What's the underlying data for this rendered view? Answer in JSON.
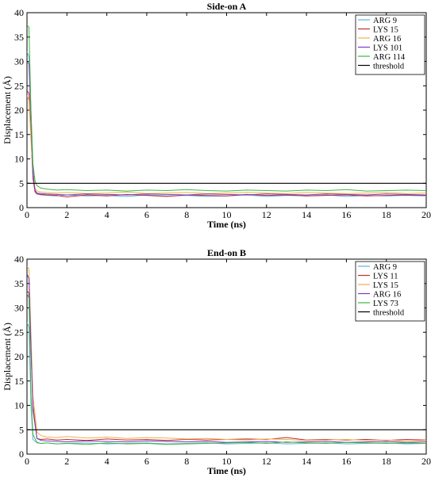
{
  "chart_data": [
    {
      "type": "line",
      "title": "Side-on A",
      "xlabel": "Time (ns)",
      "ylabel": "Displacement (Å)",
      "xlim": [
        0,
        20
      ],
      "ylim": [
        0,
        40
      ],
      "xticks": [
        "0",
        "2",
        "4",
        "6",
        "8",
        "10",
        "12",
        "14",
        "16",
        "18",
        "20"
      ],
      "yticks": [
        "0",
        "5",
        "10",
        "15",
        "20",
        "25",
        "30",
        "35",
        "40"
      ],
      "grid": false,
      "legend_position": "top-right",
      "series": [
        {
          "name": "ARG 9",
          "color": "#5fb4dc",
          "x": [
            0,
            0.1,
            0.2,
            0.3,
            0.4,
            0.5,
            0.7,
            1,
            1.5,
            2,
            3,
            4,
            5,
            6,
            7,
            8,
            9,
            10,
            11,
            12,
            13,
            14,
            15,
            16,
            17,
            18,
            19,
            20
          ],
          "y": [
            32,
            31,
            20,
            8,
            3.5,
            2.8,
            2.6,
            2.5,
            2.4,
            2.6,
            2.4,
            2.5,
            2.3,
            2.6,
            2.4,
            2.5,
            2.3,
            2.4,
            2.6,
            2.3,
            2.5,
            2.4,
            2.6,
            2.3,
            2.5,
            2.4,
            2.5,
            2.4
          ]
        },
        {
          "name": "LYS 15",
          "color": "#c03030",
          "x": [
            0,
            0.1,
            0.2,
            0.3,
            0.4,
            0.5,
            0.7,
            1,
            1.5,
            2,
            3,
            4,
            5,
            6,
            7,
            8,
            9,
            10,
            11,
            12,
            13,
            14,
            15,
            16,
            17,
            18,
            19,
            20
          ],
          "y": [
            24,
            23.5,
            15,
            6,
            3.2,
            2.8,
            2.7,
            2.6,
            2.5,
            2.2,
            2.6,
            2.4,
            2.7,
            2.5,
            2.3,
            2.6,
            2.5,
            2.4,
            2.7,
            2.5,
            2.6,
            2.4,
            2.5,
            2.6,
            2.4,
            2.5,
            2.6,
            2.5
          ]
        },
        {
          "name": "ARG 16",
          "color": "#f0b04a",
          "x": [
            0,
            0.1,
            0.2,
            0.3,
            0.4,
            0.5,
            0.7,
            1,
            1.5,
            2,
            3,
            4,
            5,
            6,
            7,
            8,
            9,
            10,
            11,
            12,
            13,
            14,
            15,
            16,
            17,
            18,
            19,
            20
          ],
          "y": [
            23,
            22,
            14,
            7,
            4,
            3.4,
            3.2,
            3.1,
            3.0,
            3.1,
            2.9,
            3.0,
            3.2,
            2.9,
            3.0,
            3.1,
            2.9,
            3.0,
            3.1,
            3.0,
            2.9,
            3.1,
            3.0,
            2.9,
            3.0,
            3.1,
            2.9,
            3.0
          ]
        },
        {
          "name": "LYS 101",
          "color": "#7a3cc8",
          "x": [
            0,
            0.1,
            0.2,
            0.3,
            0.4,
            0.5,
            0.7,
            1,
            1.5,
            2,
            3,
            4,
            5,
            6,
            7,
            8,
            9,
            10,
            11,
            12,
            13,
            14,
            15,
            16,
            17,
            18,
            19,
            20
          ],
          "y": [
            30,
            29.5,
            18,
            7,
            3.6,
            3.0,
            2.9,
            2.8,
            2.7,
            2.6,
            2.8,
            2.7,
            2.6,
            2.8,
            2.7,
            2.6,
            2.8,
            2.7,
            2.6,
            2.8,
            2.7,
            2.6,
            2.8,
            2.7,
            2.6,
            2.8,
            2.7,
            2.6
          ]
        },
        {
          "name": "ARG 114",
          "color": "#3cb83c",
          "x": [
            0,
            0.1,
            0.2,
            0.3,
            0.4,
            0.5,
            0.7,
            1,
            1.5,
            2,
            3,
            4,
            5,
            6,
            7,
            8,
            9,
            10,
            11,
            12,
            13,
            14,
            15,
            16,
            17,
            18,
            19,
            20
          ],
          "y": [
            37.5,
            37,
            20,
            9,
            5.5,
            4.5,
            4.0,
            3.8,
            3.6,
            3.7,
            3.5,
            3.6,
            3.4,
            3.6,
            3.5,
            3.7,
            3.5,
            3.4,
            3.6,
            3.5,
            3.4,
            3.6,
            3.5,
            3.7,
            3.4,
            3.5,
            3.6,
            3.5
          ]
        },
        {
          "name": "threshold",
          "color": "#000000",
          "x": [
            0,
            20
          ],
          "y": [
            5,
            5
          ]
        }
      ]
    },
    {
      "type": "line",
      "title": "End-on B",
      "xlabel": "Time (ns)",
      "ylabel": "Displacement (Å)",
      "xlim": [
        0,
        20
      ],
      "ylim": [
        0,
        40
      ],
      "xticks": [
        "0",
        "2",
        "4",
        "6",
        "8",
        "10",
        "12",
        "14",
        "16",
        "18",
        "20"
      ],
      "yticks": [
        "0",
        "5",
        "10",
        "15",
        "20",
        "25",
        "30",
        "35",
        "40"
      ],
      "grid": false,
      "legend_position": "top-right",
      "series": [
        {
          "name": "ARG 9",
          "color": "#5fb4dc",
          "x": [
            0,
            0.1,
            0.2,
            0.3,
            0.5,
            0.7,
            1,
            1.5,
            2,
            3,
            4,
            5,
            6,
            7,
            8,
            9,
            10,
            11,
            12,
            13,
            14,
            15,
            16,
            17,
            18,
            19,
            20
          ],
          "y": [
            27,
            26,
            10,
            3,
            2.3,
            2.2,
            2.3,
            2.1,
            2.2,
            2.3,
            2.1,
            2.2,
            2.3,
            2.1,
            2.2,
            2.3,
            2.1,
            2.2,
            2.3,
            2.1,
            2.2,
            2.3,
            2.1,
            2.2,
            2.3,
            2.1,
            2.2
          ]
        },
        {
          "name": "LYS 11",
          "color": "#c03030",
          "x": [
            0,
            0.1,
            0.2,
            0.3,
            0.5,
            0.7,
            1,
            1.5,
            2,
            3,
            4,
            5,
            6,
            7,
            8,
            9,
            10,
            11,
            12,
            13,
            14,
            15,
            16,
            17,
            18,
            19,
            20
          ],
          "y": [
            33.5,
            33,
            22,
            10,
            3.2,
            3.0,
            3.1,
            2.9,
            3.0,
            2.8,
            3.1,
            2.9,
            3.0,
            2.8,
            3.0,
            2.9,
            3.0,
            3.1,
            3.0,
            3.4,
            2.9,
            3.0,
            2.9,
            3.0,
            2.8,
            3.0,
            2.9
          ]
        },
        {
          "name": "LYS 15",
          "color": "#f0b04a",
          "x": [
            0,
            0.1,
            0.2,
            0.3,
            0.5,
            0.7,
            1,
            1.5,
            2,
            3,
            4,
            5,
            6,
            7,
            8,
            9,
            10,
            11,
            12,
            13,
            14,
            15,
            16,
            17,
            18,
            19,
            20
          ],
          "y": [
            38.5,
            38,
            25,
            12,
            4.5,
            3.8,
            3.5,
            3.4,
            3.6,
            3.3,
            3.5,
            3.2,
            3.4,
            3.3,
            3.1,
            3.2,
            3.0,
            2.9,
            3.1,
            3.0,
            2.8,
            2.9,
            3.0,
            2.8,
            2.9,
            2.7,
            2.8
          ]
        },
        {
          "name": "ARG 16",
          "color": "#7a3cc8",
          "x": [
            0,
            0.1,
            0.2,
            0.3,
            0.5,
            0.7,
            1,
            1.5,
            2,
            3,
            4,
            5,
            6,
            7,
            8,
            9,
            10,
            11,
            12,
            13,
            14,
            15,
            16,
            17,
            18,
            19,
            20
          ],
          "y": [
            37,
            36,
            22,
            9,
            3.2,
            2.8,
            2.7,
            2.6,
            2.5,
            2.7,
            2.6,
            2.5,
            2.7,
            2.6,
            2.5,
            2.6,
            2.4,
            2.5,
            2.6,
            2.4,
            2.5,
            2.6,
            2.4,
            2.5,
            2.6,
            2.4,
            2.5
          ]
        },
        {
          "name": "LYS 73",
          "color": "#3cb83c",
          "x": [
            0,
            0.1,
            0.2,
            0.3,
            0.5,
            0.7,
            1,
            1.5,
            2,
            3,
            4,
            5,
            6,
            7,
            8,
            9,
            10,
            11,
            12,
            13,
            14,
            15,
            16,
            17,
            18,
            19,
            20
          ],
          "y": [
            33,
            32,
            12,
            4,
            2.4,
            2.2,
            2.3,
            2.1,
            2.2,
            2.0,
            2.3,
            2.1,
            2.2,
            2.0,
            2.1,
            2.2,
            2.3,
            2.4,
            2.2,
            2.5,
            2.3,
            2.2,
            2.4,
            2.3,
            2.2,
            2.3,
            2.2
          ]
        },
        {
          "name": "threshold",
          "color": "#000000",
          "x": [
            0,
            20
          ],
          "y": [
            5,
            5
          ]
        }
      ]
    }
  ]
}
